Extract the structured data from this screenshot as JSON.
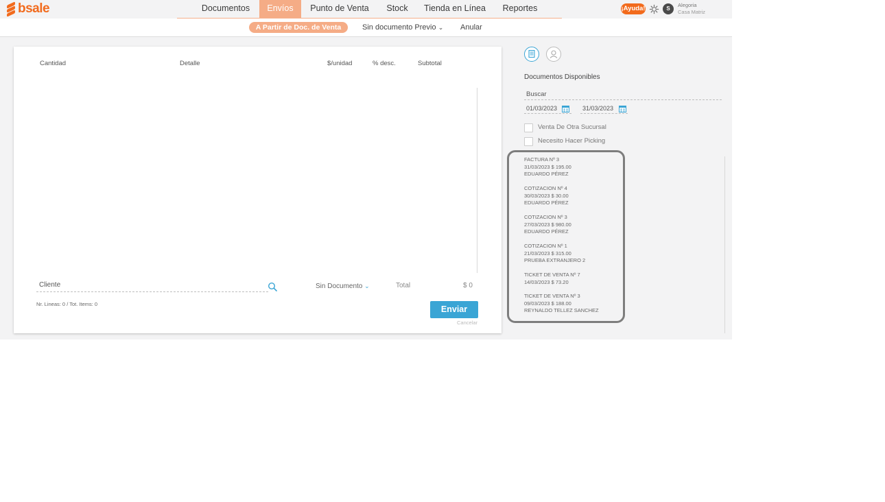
{
  "brand": {
    "name": "bsale",
    "color": "#f26b1d"
  },
  "nav": {
    "items": [
      {
        "label": "Documentos"
      },
      {
        "label": "Envíos"
      },
      {
        "label": "Punto de Venta"
      },
      {
        "label": "Stock"
      },
      {
        "label": "Tienda en Línea"
      },
      {
        "label": "Reportes"
      }
    ],
    "active_index": 1
  },
  "header": {
    "help_label": "¡Ayuda!",
    "avatar_initial": "S",
    "company": "Alegoria",
    "branch": "Casa Matriz"
  },
  "subnav": {
    "active_label": "A Partir de Doc. de Venta",
    "sin_documento_label": "Sin documento Previo",
    "anular_label": "Anular"
  },
  "table": {
    "columns": [
      "Cantidad",
      "Detalle",
      "$/unidad",
      "% desc.",
      "Subtotal"
    ]
  },
  "form": {
    "cliente_placeholder": "Cliente",
    "sin_documento_label": "Sin Documento",
    "total_label": "Total",
    "total_value": "$ 0",
    "line_info": "Nr. Lineas: 0 / Tot. Items: 0",
    "enviar_label": "Enviar",
    "cancelar_label": "Cancelar"
  },
  "right_panel": {
    "title": "Documentos Disponibles",
    "search_placeholder": "Buscar",
    "date_from": "01/03/2023",
    "date_to": "31/03/2023",
    "checkbox_otra_sucursal": "Venta De Otra Sucursal",
    "checkbox_picking": "Necesito Hacer Picking",
    "documents": [
      {
        "title": "FACTURA Nº 3",
        "detail": "31/03/2023 $ 195.00",
        "client": "EDUARDO PÉREZ"
      },
      {
        "title": "COTIZACION Nº 4",
        "detail": "30/03/2023 $ 30.00",
        "client": "EDUARDO PÉREZ"
      },
      {
        "title": "COTIZACION Nº 3",
        "detail": "27/03/2023 $ 980.00",
        "client": "EDUARDO PÉREZ"
      },
      {
        "title": "COTIZACION Nº 1",
        "detail": "21/03/2023 $ 315.00",
        "client": "PRUEBA EXTRANJERO 2"
      },
      {
        "title": "TICKET DE VENTA Nº 7",
        "detail": "14/03/2023 $ 73.20",
        "client": ""
      },
      {
        "title": "TICKET DE VENTA Nº 3",
        "detail": "09/03/2023 $ 188.00",
        "client": "REYNALDO TELLEZ SANCHEZ"
      }
    ]
  },
  "colors": {
    "accent_orange": "#f26b1d",
    "accent_light_orange": "#f5ac86",
    "accent_blue": "#3aa5d5"
  }
}
